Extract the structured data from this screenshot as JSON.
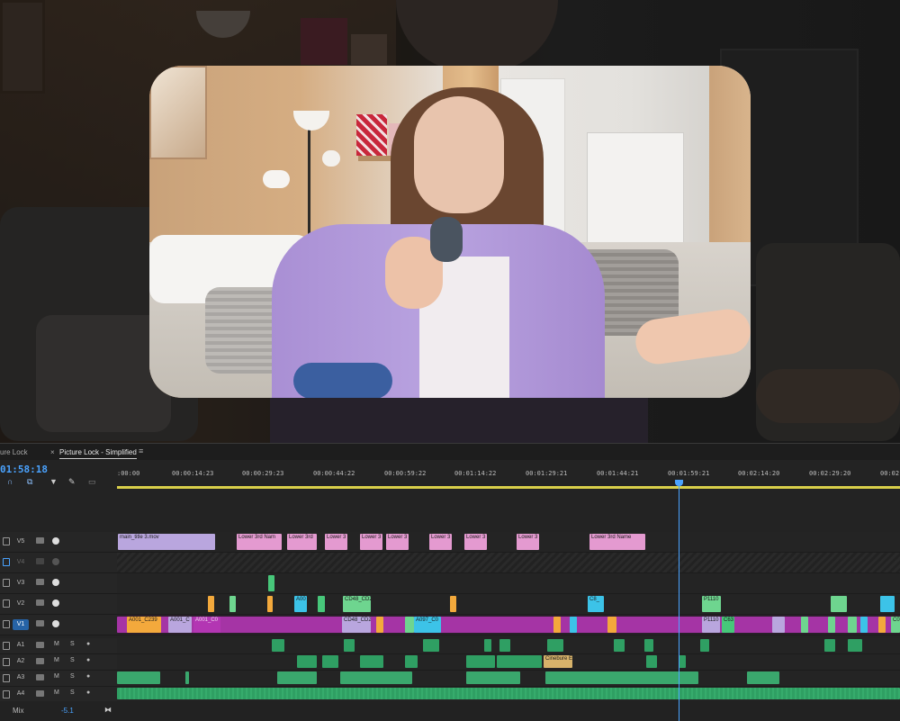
{
  "timeline": {
    "tabs": [
      "ure Lock",
      "Picture Lock - Simplified"
    ],
    "menu_icon": "hamburger-icon",
    "timecode": "01:58:18",
    "ruler_labels": [
      ":00:00",
      "00:00:14:23",
      "00:00:29:23",
      "00:00:44:22",
      "00:00:59:22",
      "00:01:14:22",
      "00:01:29:21",
      "00:01:44:21",
      "00:01:59:21",
      "00:02:14:20",
      "00:02:29:20",
      "00:02-"
    ],
    "video_tracks": [
      "V5",
      "V4",
      "V3",
      "V2",
      "V1"
    ],
    "audio_tracks": [
      "A1",
      "A2",
      "A3",
      "A4"
    ],
    "track_controls": {
      "mute": "M",
      "solo": "S"
    },
    "v5_clips": [
      "main_title 3.mov",
      "Lower 3rd Nam",
      "Lower 3rd",
      "Lower 3",
      "Lower 3",
      "Lower 3",
      "Lower 3",
      "Lower 3",
      "Lower 3",
      "Lower 3rd Name"
    ],
    "v2_clips": [
      "A00",
      "CD48_CD2",
      "C8_",
      "P1110"
    ],
    "v1_clips": [
      "A001_C239",
      "A001_C",
      "A001_C0",
      "CD48_CD2",
      "A097_C0",
      "P1110",
      "C63",
      "C0"
    ],
    "a2_clips": [
      "Cinebure E"
    ],
    "mix": {
      "label": "Mix",
      "value": "-5.1"
    }
  },
  "colors": {
    "accent": "#4aa3ff",
    "workbar": "#d9cf4a",
    "clip_magenta": "#b336b3",
    "clip_pink": "#e49ad0",
    "audio_green": "#2f9f63"
  }
}
